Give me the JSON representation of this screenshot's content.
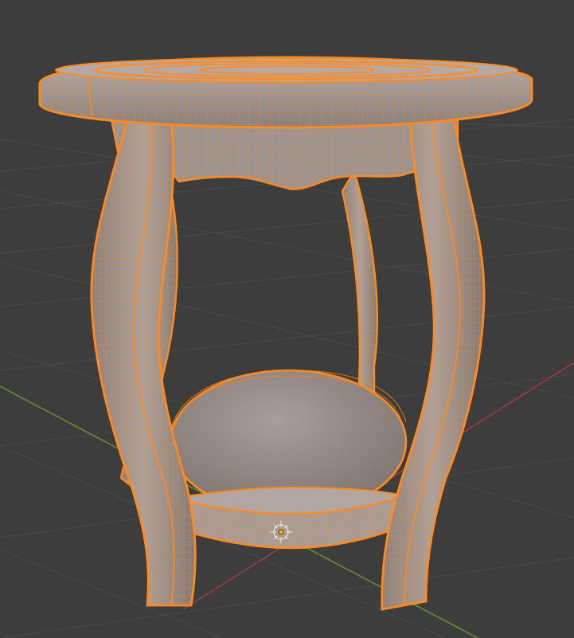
{
  "viewport": {
    "background_color": "#3d3d3d",
    "grid_line_color": "#4a4a4a",
    "x_axis_color": "#9a3d48",
    "y_axis_color": "#6a8a2e"
  },
  "object": {
    "selected": true,
    "outline_color": "#ff8a1f",
    "wire_color": "#f2891c",
    "surface_color": "#9b8f8c",
    "surface_dark_color": "#7d716d",
    "surface_light_color": "#b3a7a3"
  },
  "origin_gizmo": {
    "icon": "object-origin-icon"
  }
}
